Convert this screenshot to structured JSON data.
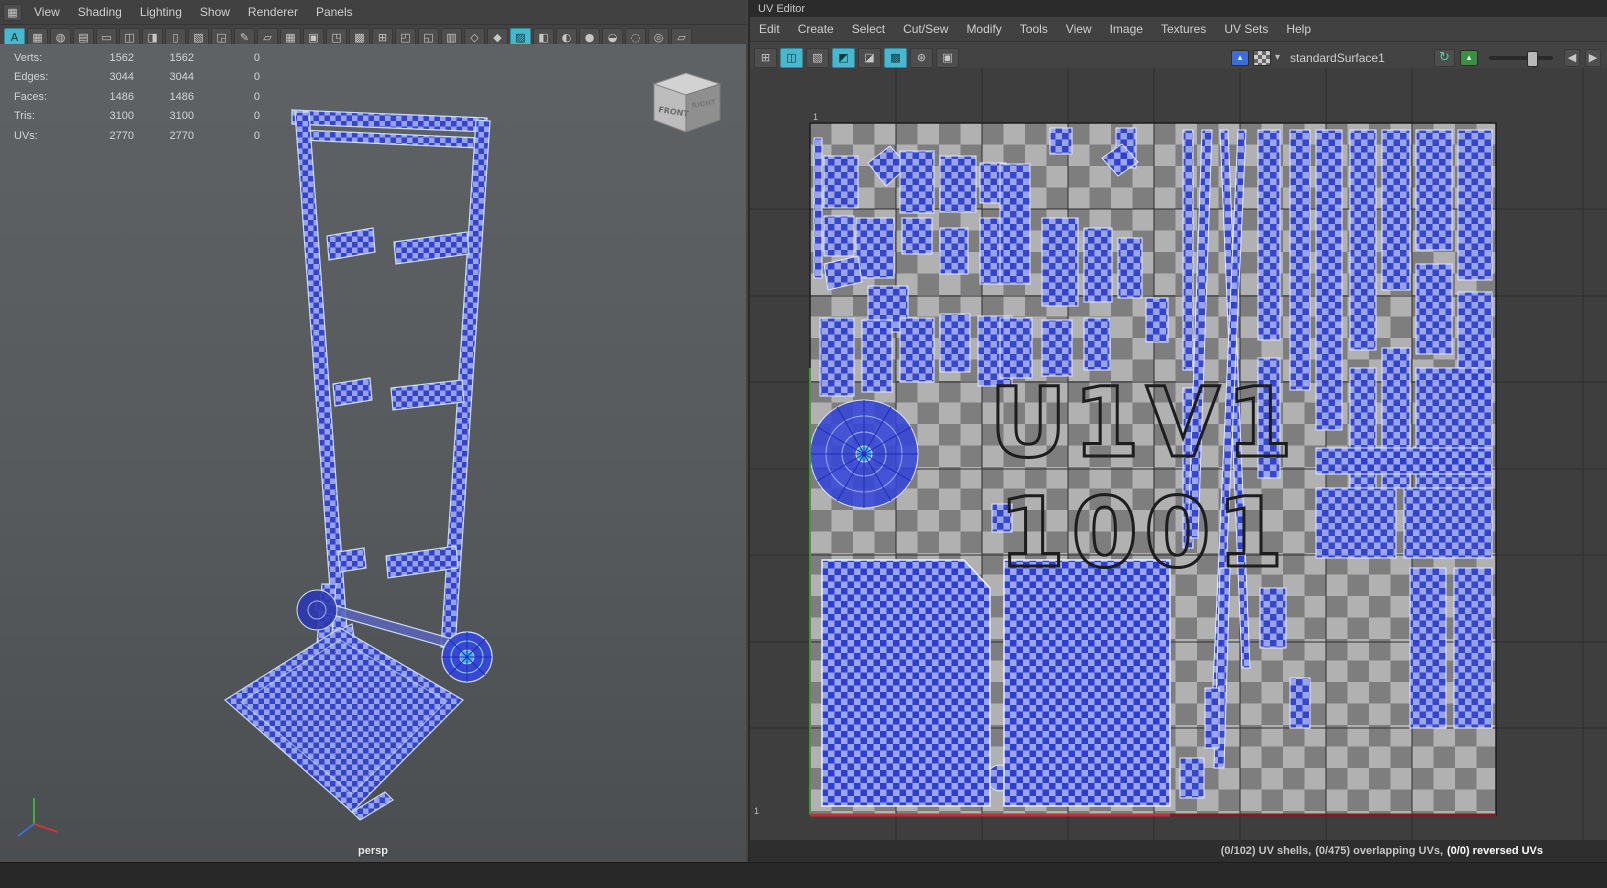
{
  "colors": {
    "accent": "#49b8cf",
    "shell_blue": "#3a49d6",
    "viewport_bg": "#565a5c",
    "uv_background": "#3e3e3e",
    "axis_u_red": "#b23030",
    "axis_v_green": "#3f9b35"
  },
  "left_panel": {
    "menus": [
      "View",
      "Shading",
      "Lighting",
      "Show",
      "Renderer",
      "Panels"
    ],
    "toolbar_icons": [
      {
        "name": "selection-mask-icon",
        "glyph": "A",
        "accent": true
      },
      {
        "name": "grid-display-icon",
        "glyph": "▦"
      },
      {
        "name": "sphere-display-icon",
        "glyph": "◍"
      },
      {
        "name": "flat-shade-icon",
        "glyph": "▤"
      },
      {
        "name": "select-camera-icon",
        "glyph": "▭"
      },
      {
        "name": "lock-camera-icon",
        "glyph": "◫"
      },
      {
        "name": "camera-attributes-icon",
        "glyph": "◨"
      },
      {
        "name": "bookmarks-icon",
        "glyph": "▯"
      },
      {
        "name": "image-plane-icon",
        "glyph": "▧"
      },
      {
        "name": "two-d-pan-zoom-icon",
        "glyph": "◲"
      },
      {
        "name": "grease-pencil-icon",
        "glyph": "✎"
      },
      {
        "name": "annotate-icon",
        "glyph": "▱"
      },
      {
        "name": "grid-toggle-icon",
        "glyph": "▦"
      },
      {
        "name": "film-gate-icon",
        "glyph": "▣"
      },
      {
        "name": "resolution-gate-icon",
        "glyph": "◳"
      },
      {
        "name": "gate-mask-icon",
        "glyph": "▩"
      },
      {
        "name": "field-chart-icon",
        "glyph": "⊞"
      },
      {
        "name": "safe-action-icon",
        "glyph": "◰"
      },
      {
        "name": "safe-title-icon",
        "glyph": "◱"
      },
      {
        "name": "hud-toggle-icon",
        "glyph": "▥"
      },
      {
        "name": "wireframe-icon",
        "glyph": "◇"
      },
      {
        "name": "shaded-icon",
        "glyph": "◆"
      },
      {
        "name": "textured-icon",
        "glyph": "▨",
        "accent": true
      },
      {
        "name": "use-default-material-icon",
        "glyph": "◧"
      },
      {
        "name": "lighting-icon",
        "glyph": "◐"
      },
      {
        "name": "shadows-icon",
        "glyph": "●"
      },
      {
        "name": "occlusion-icon",
        "glyph": "◒"
      },
      {
        "name": "motion-blur-icon",
        "glyph": "◌"
      },
      {
        "name": "isolate-select-icon",
        "glyph": "◎"
      },
      {
        "name": "xray-icon",
        "glyph": "▱"
      }
    ],
    "hud": {
      "rows": [
        {
          "label": "Verts:",
          "v1": "1562",
          "v2": "1562",
          "v3": "0"
        },
        {
          "label": "Edges:",
          "v1": "3044",
          "v2": "3044",
          "v3": "0"
        },
        {
          "label": "Faces:",
          "v1": "1486",
          "v2": "1486",
          "v3": "0"
        },
        {
          "label": "Tris:",
          "v1": "3100",
          "v2": "3100",
          "v3": "0"
        },
        {
          "label": "UVs:",
          "v1": "2770",
          "v2": "2770",
          "v3": "0"
        }
      ]
    },
    "camera_label": "persp",
    "viewcube": {
      "front": "FRONT",
      "right": "RIGHT"
    }
  },
  "uv_editor": {
    "title": "UV Editor",
    "menus": [
      "Edit",
      "Create",
      "Select",
      "Cut/Sew",
      "Modify",
      "Tools",
      "View",
      "Image",
      "Textures",
      "UV Sets",
      "Help"
    ],
    "toolbar_icons": [
      {
        "name": "uv-lattice-icon",
        "glyph": "⊞"
      },
      {
        "name": "move-uv-shell-icon",
        "glyph": "◫",
        "accent": true
      },
      {
        "name": "uv-layout-icon",
        "glyph": "▧"
      },
      {
        "name": "cut-uv-tool-icon",
        "glyph": "◩",
        "accent": true
      },
      {
        "name": "sew-uv-tool-icon",
        "glyph": "◪"
      },
      {
        "name": "pixel-snap-icon",
        "glyph": "▩",
        "accent": true
      },
      {
        "name": "settings-gear-icon",
        "glyph": "⊛"
      },
      {
        "name": "uv-snapshot-icon",
        "glyph": "▣"
      }
    ],
    "toolbar": {
      "texture_name": "standardSurface1",
      "dropdown_caret": "▾"
    },
    "tile": {
      "label_top": "U1V1",
      "label_bottom": "1001",
      "tick_top": "1",
      "tick_bottom": "1"
    },
    "status": {
      "shells": "(0/102) UV shells,",
      "overlap": "(0/475) overlapping UVs,",
      "reversed": "(0/0) reversed UVs"
    }
  }
}
